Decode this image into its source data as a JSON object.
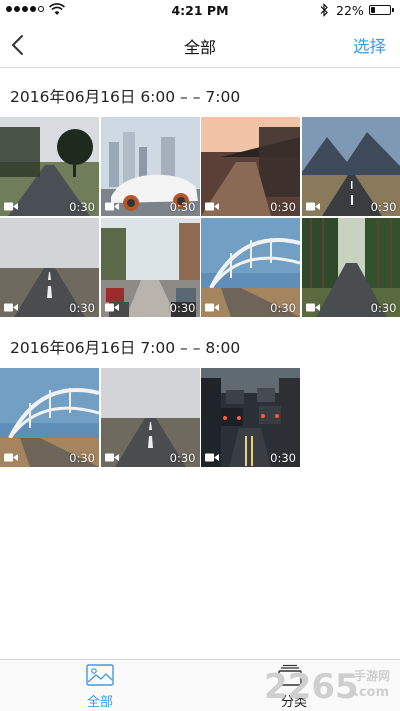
{
  "status_bar": {
    "time": "4:21 PM",
    "battery_percent_label": "22%",
    "battery_level": 0.22,
    "signal_bars": 4
  },
  "nav": {
    "title": "全部",
    "select_label": "选择",
    "back_icon": "chevron-left-icon"
  },
  "groups": [
    {
      "header": "2016年06月16日 6:00 – – 7:00",
      "items": [
        {
          "scene": "road-trees",
          "duration": "0:30"
        },
        {
          "scene": "white-car-city",
          "duration": "0:30"
        },
        {
          "scene": "sunset-boardwalk",
          "duration": "0:30"
        },
        {
          "scene": "mountain-road",
          "duration": "0:30"
        },
        {
          "scene": "cloudy-road",
          "duration": "0:30"
        },
        {
          "scene": "city-street-cars",
          "duration": "0:30"
        },
        {
          "scene": "bridge-road",
          "duration": "0:30"
        },
        {
          "scene": "forest-road",
          "duration": "0:30"
        }
      ]
    },
    {
      "header": "2016年06月16日 7:00 – – 8:00",
      "items": [
        {
          "scene": "bridge-road",
          "duration": "0:30"
        },
        {
          "scene": "cloudy-road",
          "duration": "0:30"
        },
        {
          "scene": "traffic-jam",
          "duration": "0:30"
        }
      ]
    }
  ],
  "tab_bar": {
    "tabs": [
      {
        "label": "全部",
        "icon": "image-icon",
        "active": true
      },
      {
        "label": "分类",
        "icon": "category-icon",
        "active": false
      }
    ]
  },
  "watermark": {
    "text": "2265",
    "sub_text": "手游网",
    "domain": ".com"
  },
  "colors": {
    "accent": "#3d9be9",
    "divider": "#d9d9d9"
  }
}
